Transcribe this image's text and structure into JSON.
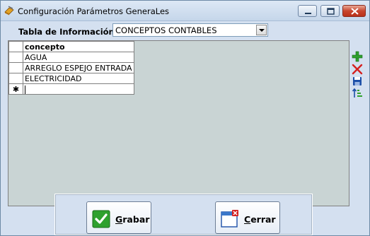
{
  "window": {
    "title": "Configuración Parámetros GeneraLes"
  },
  "form": {
    "tabla_label": "Tabla de Información:",
    "tabla_value": "CONCEPTOS CONTABLES"
  },
  "grid": {
    "column_header": "concepto",
    "rows": [
      "AGUA",
      "ARREGLO ESPEJO ENTRADA",
      "ELECTRICIDAD"
    ],
    "new_row_marker": "✱"
  },
  "side_tools": [
    "add-icon",
    "delete-icon",
    "save-icon",
    "sort-icon"
  ],
  "buttons": {
    "grabar": "Grabar",
    "cerrar": "Cerrar"
  },
  "colors": {
    "accent_green": "#2fa12f",
    "delete_red": "#d42020",
    "save_blue": "#1c4fa8",
    "close_red": "#c8452d"
  }
}
